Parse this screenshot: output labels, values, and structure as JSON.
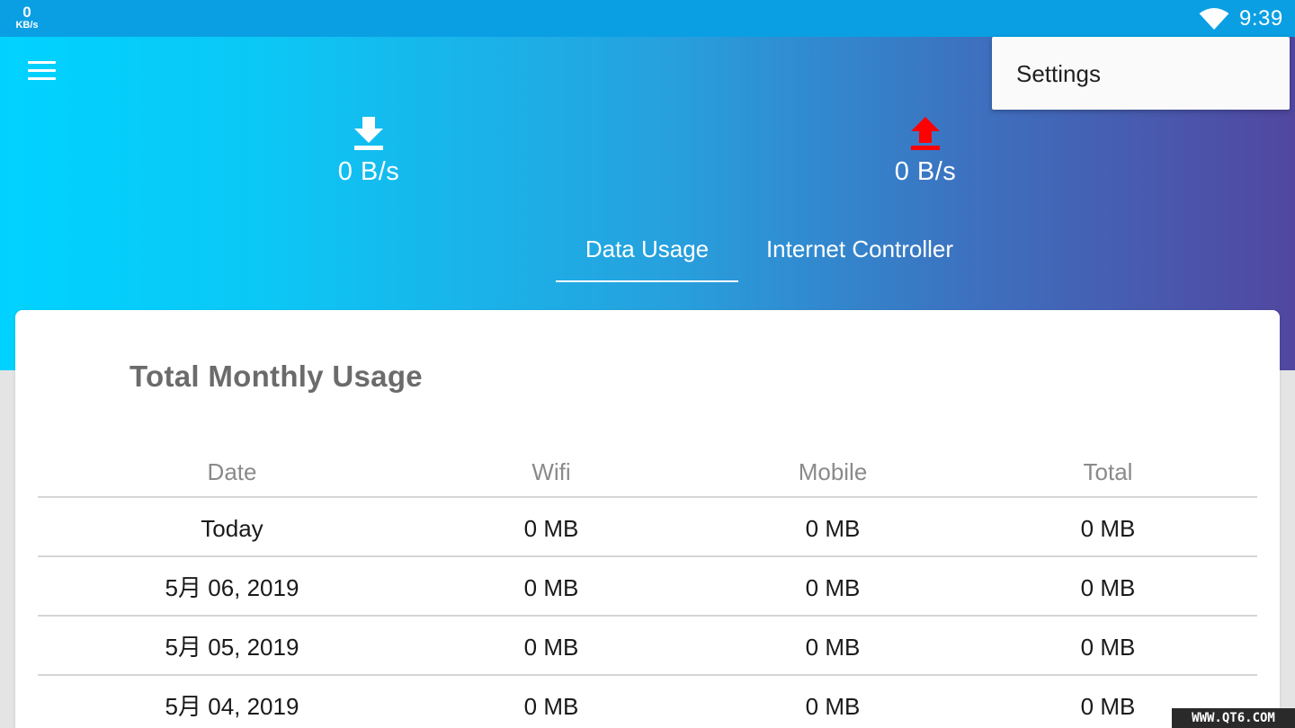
{
  "status_bar": {
    "net_speed_value": "0",
    "net_speed_unit": "KB/s",
    "wifi_icon": "wifi-icon",
    "time": "9:39"
  },
  "header": {
    "menu_icon": "menu-icon",
    "download": {
      "icon": "download-arrow-icon",
      "value": "0 B/s",
      "color": "#ffffff"
    },
    "upload": {
      "icon": "upload-arrow-icon",
      "value": "0 B/s",
      "color": "#ff0000"
    },
    "tabs": [
      {
        "label": "Data Usage",
        "active": true
      },
      {
        "label": "Internet Controller",
        "active": false
      }
    ],
    "gradient": [
      "#00d2ff",
      "#5147a0"
    ]
  },
  "overflow_menu": {
    "items": [
      {
        "label": "Settings"
      }
    ]
  },
  "card": {
    "title": "Total Monthly Usage",
    "columns": [
      "Date",
      "Wifi",
      "Mobile",
      "Total"
    ],
    "rows": [
      [
        "Today",
        "0 MB",
        "0 MB",
        "0 MB"
      ],
      [
        "5月 06, 2019",
        "0 MB",
        "0 MB",
        "0 MB"
      ],
      [
        "5月 05, 2019",
        "0 MB",
        "0 MB",
        "0 MB"
      ],
      [
        "5月 04, 2019",
        "0 MB",
        "0 MB",
        "0 MB"
      ]
    ]
  },
  "watermark": "WWW.QT6.COM"
}
